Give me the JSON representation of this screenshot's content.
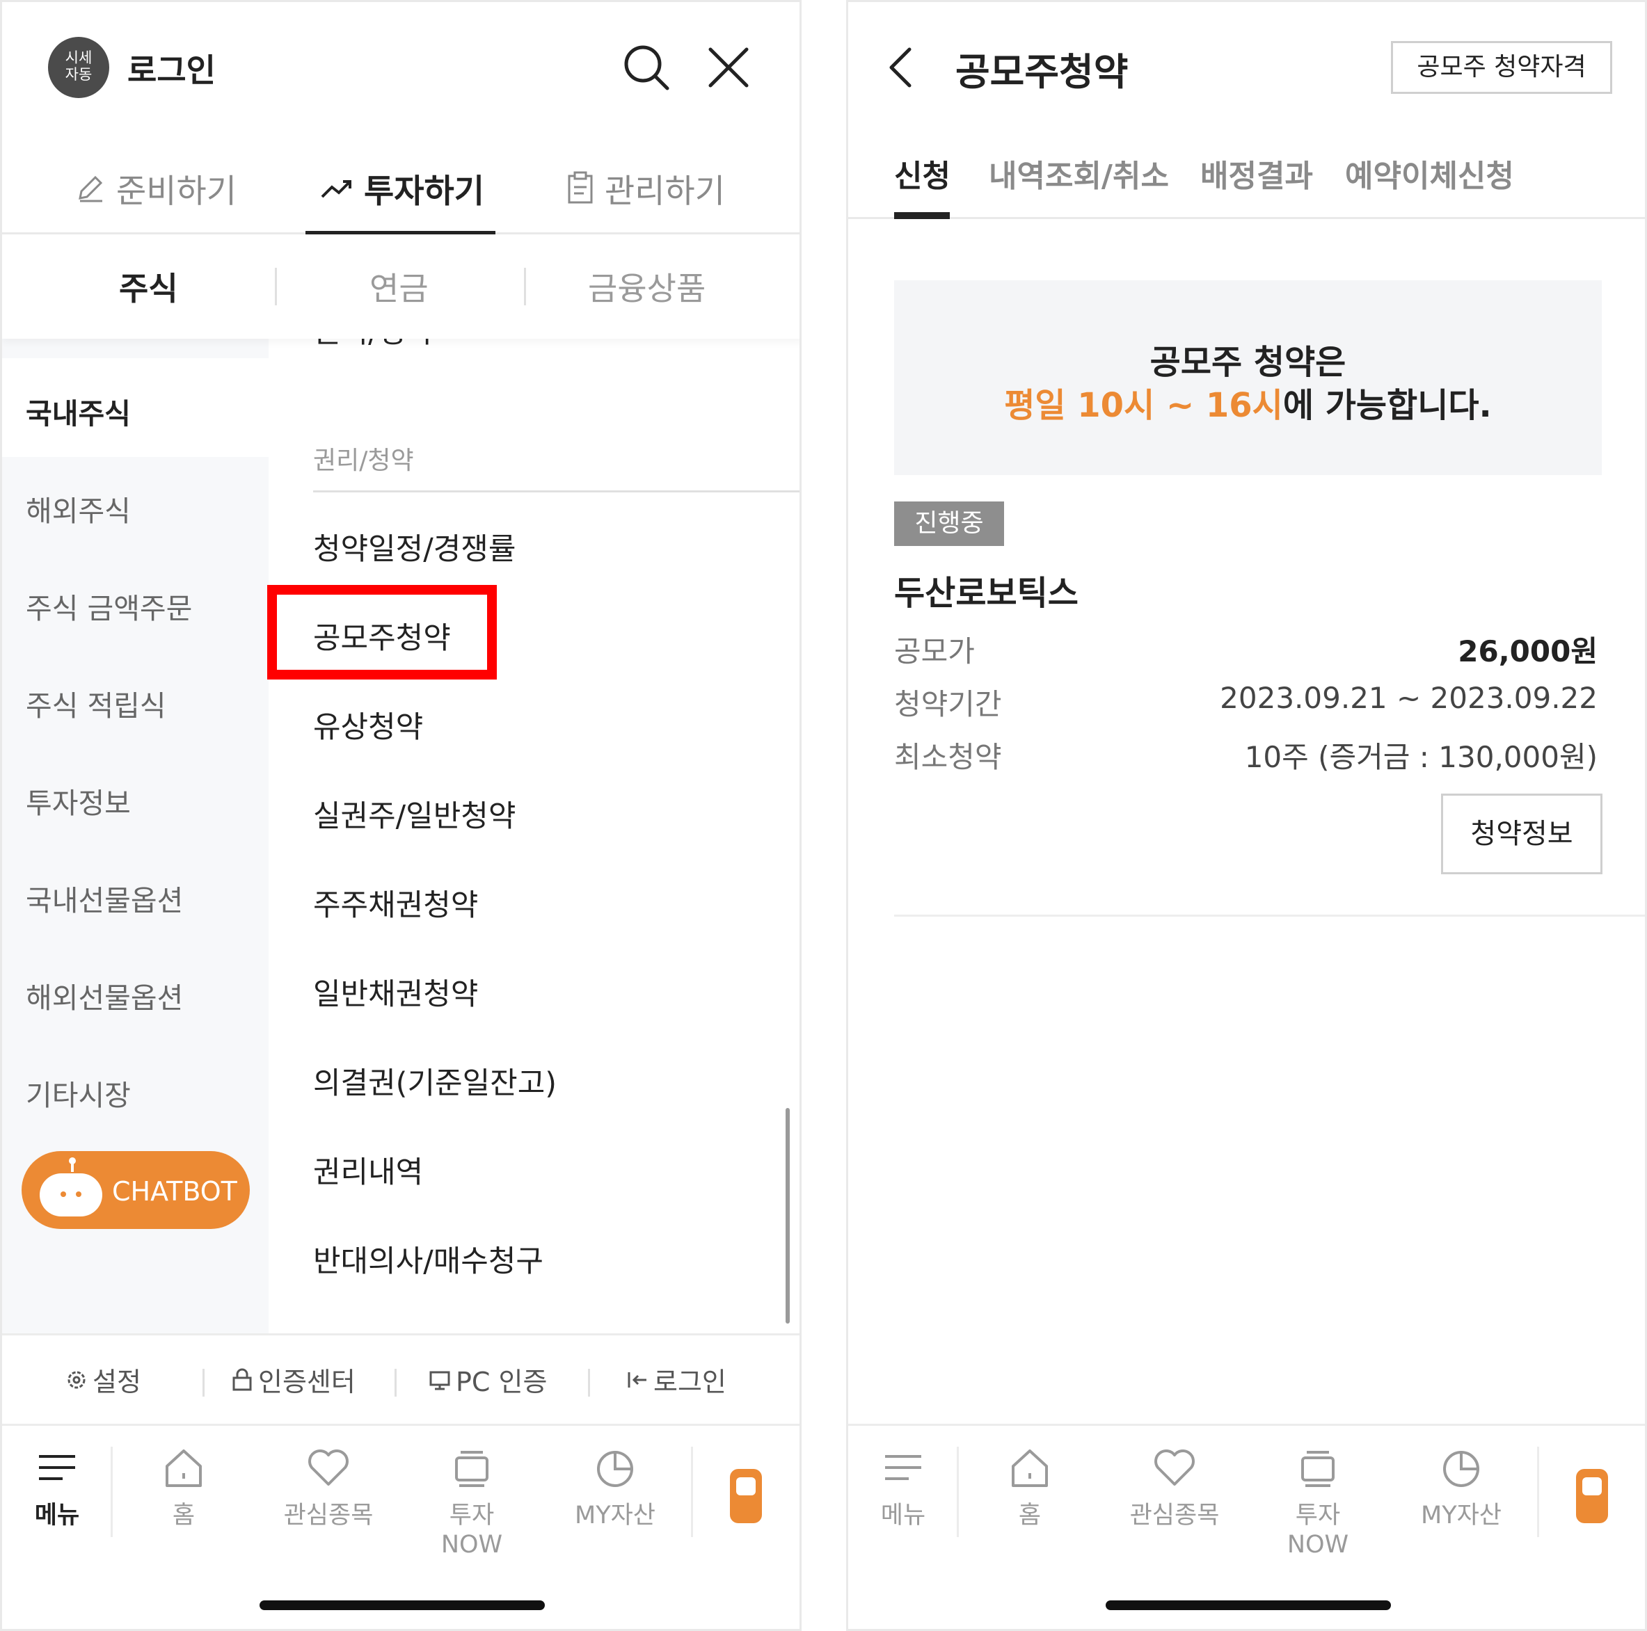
{
  "left": {
    "header": {
      "avatar_lines": [
        "시세",
        "자동"
      ],
      "title": "로그인"
    },
    "top_tabs": [
      "준비하기",
      "투자하기",
      "관리하기"
    ],
    "sub_tabs": [
      "주식",
      "연금",
      "금융상품"
    ],
    "sidebar": [
      "국내주식",
      "해외주식",
      "주식 금액주문",
      "주식 적립식",
      "투자정보",
      "국내선물옵션",
      "해외선물옵션",
      "기타시장"
    ],
    "chatbot_label": "CHATBOT",
    "cut_off_item": "권리/청약",
    "section_title": "권리/청약",
    "menu_items": [
      "청약일정/경쟁률",
      "공모주청약",
      "유상청약",
      "실권주/일반청약",
      "주주채권청약",
      "일반채권청약",
      "의결권(기준일잔고)",
      "권리내역",
      "반대의사/매수청구"
    ],
    "util_bar": [
      "설정",
      "인증센터",
      "PC 인증",
      "로그인"
    ],
    "nav": [
      "메뉴",
      "홈",
      "관심종목",
      "투자NOW",
      "MY자산"
    ]
  },
  "right": {
    "title": "공모주청약",
    "qualification_button": "공모주 청약자격",
    "tabs": [
      "신청",
      "내역조회/취소",
      "배정결과",
      "예약이체신청"
    ],
    "notice": {
      "line1": "공모주 청약은",
      "highlight": "평일 10시 ~ 16시",
      "line2_rest": "에 가능합니다."
    },
    "status_badge": "진행중",
    "company": "두산로보틱스",
    "info": [
      {
        "label": "공모가",
        "value": "26,000원"
      },
      {
        "label": "청약기간",
        "value": "2023.09.21 ~ 2023.09.22"
      },
      {
        "label": "최소청약",
        "value": "10주 (증거금 : 130,000원)"
      }
    ],
    "info_button": "청약정보",
    "nav": [
      "메뉴",
      "홈",
      "관심종목",
      "투자NOW",
      "MY자산"
    ]
  },
  "colors": {
    "accent": "#ec8a34",
    "highlight_box": "#ff0000",
    "text": "#222222",
    "muted": "#8a8a8a"
  }
}
